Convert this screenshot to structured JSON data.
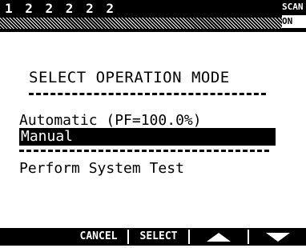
{
  "status": {
    "channels": "1 2 2 2 2 2",
    "scan_label": "SCAN",
    "scan_value": "ON"
  },
  "screen": {
    "title": "SELECT OPERATION MODE",
    "options": [
      {
        "label": "Automatic (PF=100.0%)",
        "selected": false
      },
      {
        "label": "Manual",
        "selected": true
      },
      {
        "label": "Perform System Test",
        "selected": false
      }
    ]
  },
  "softkeys": {
    "cancel": "CANCEL",
    "select": "SELECT",
    "up_icon": "up-arrow-icon",
    "down_icon": "down-arrow-icon"
  },
  "colors": {
    "foreground": "#000000",
    "background": "#ffffff"
  }
}
